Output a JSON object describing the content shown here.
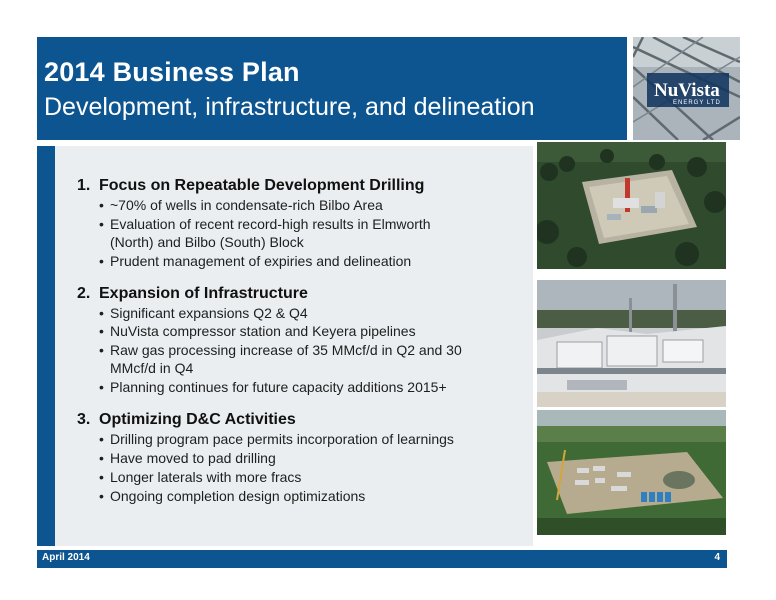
{
  "header": {
    "title": "2014 Business Plan",
    "subtitle": "Development, infrastructure, and delineation"
  },
  "logo": {
    "text": "NuVista",
    "tagline": "ENERGY LTD"
  },
  "sections": [
    {
      "number": "1.",
      "title": "Focus on Repeatable Development Drilling",
      "bullets": [
        "~70% of wells in condensate-rich Bilbo Area",
        "Evaluation of recent record-high results in Elmworth",
        "(North) and Bilbo (South) Block",
        "Prudent management of expiries and delineation"
      ]
    },
    {
      "number": "2.",
      "title": "Expansion of Infrastructure",
      "bullets": [
        "Significant expansions Q2 & Q4",
        "NuVista compressor station and Keyera pipelines",
        "Raw gas processing increase of 35 MMcf/d in Q2 and 30",
        "MMcf/d in Q4",
        "Planning continues for future capacity additions 2015+"
      ]
    },
    {
      "number": "3.",
      "title": "Optimizing D&C Activities",
      "bullets": [
        "Drilling program pace permits incorporation of learnings",
        "Have moved to pad drilling",
        "Longer laterals with more fracs",
        "Ongoing completion design optimizations"
      ]
    }
  ],
  "footer": {
    "date": "April 2014",
    "page": "4"
  },
  "colors": {
    "brand_blue": "#0c5590",
    "panel_bg": "#eaeef1"
  }
}
